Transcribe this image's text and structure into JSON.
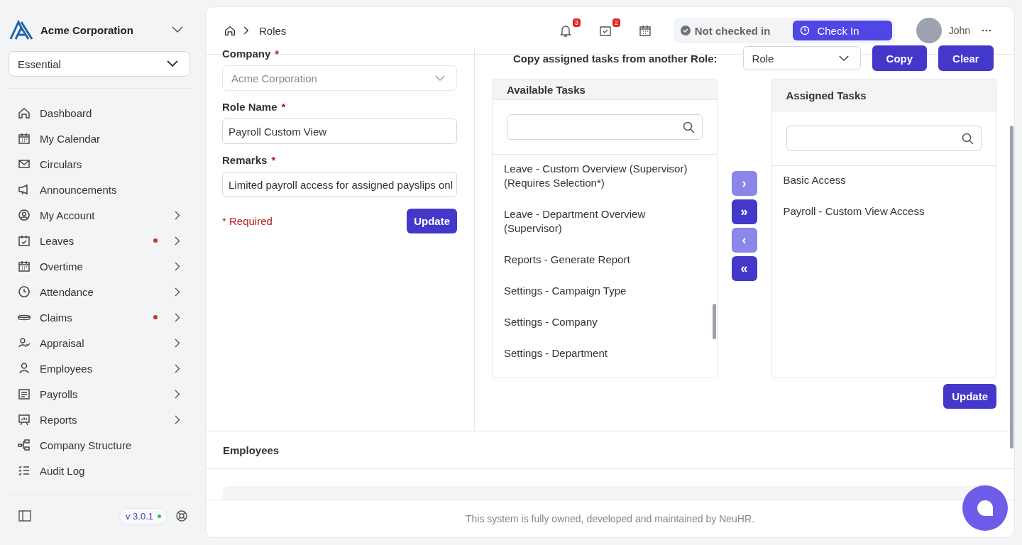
{
  "sidebar": {
    "company": "Acme Corporation",
    "plan": "Essential",
    "items": [
      {
        "label": "Dashboard",
        "expandable": false,
        "dot": false
      },
      {
        "label": "My Calendar",
        "expandable": false,
        "dot": false
      },
      {
        "label": "Circulars",
        "expandable": false,
        "dot": false
      },
      {
        "label": "Announcements",
        "expandable": false,
        "dot": false
      },
      {
        "label": "My Account",
        "expandable": true,
        "dot": false
      },
      {
        "label": "Leaves",
        "expandable": true,
        "dot": true
      },
      {
        "label": "Overtime",
        "expandable": true,
        "dot": false
      },
      {
        "label": "Attendance",
        "expandable": true,
        "dot": false
      },
      {
        "label": "Claims",
        "expandable": true,
        "dot": true
      },
      {
        "label": "Appraisal",
        "expandable": true,
        "dot": false
      },
      {
        "label": "Employees",
        "expandable": true,
        "dot": false
      },
      {
        "label": "Payrolls",
        "expandable": true,
        "dot": false
      },
      {
        "label": "Reports",
        "expandable": true,
        "dot": false
      },
      {
        "label": "Company Structure",
        "expandable": false,
        "dot": false
      },
      {
        "label": "Audit Log",
        "expandable": false,
        "dot": false
      }
    ],
    "version": "v 3.0.1"
  },
  "header": {
    "breadcrumb": "Roles",
    "notifications": "3",
    "tasks": "2",
    "status": "Not checked in",
    "check_in": "Check In",
    "user": "John"
  },
  "form": {
    "fields": [
      {
        "label": "Company",
        "required_mark": "*",
        "value": "Acme Corporation",
        "disabled": true,
        "kind": "select"
      },
      {
        "label": "Role Name",
        "required_mark": "*",
        "value": "Payroll Custom View",
        "disabled": false,
        "kind": "input"
      },
      {
        "label": "Remarks",
        "required_mark": "*",
        "value": "Limited payroll access for assigned payslips onl",
        "disabled": false,
        "kind": "input"
      }
    ],
    "required_note": "* Required",
    "update": "Update"
  },
  "copy": {
    "label": "Copy assigned tasks from another Role:",
    "select": "Role",
    "copy": "Copy",
    "clear": "Clear"
  },
  "available": {
    "title": "Available Tasks",
    "items": [
      "Leave - Custom Overview (Supervisor) (Requires Selection*)",
      "Leave - Department Overview (Supervisor)",
      "Reports - Generate Report",
      "Settings - Campaign Type",
      "Settings - Company",
      "Settings - Department"
    ]
  },
  "transfer": [
    {
      "symbol": "›",
      "disabled": true
    },
    {
      "symbol": "»",
      "disabled": false
    },
    {
      "symbol": "‹",
      "disabled": true
    },
    {
      "symbol": "«",
      "disabled": false
    }
  ],
  "assigned": {
    "title": "Assigned Tasks",
    "items": [
      "Basic Access",
      "Payroll - Custom View Access"
    ]
  },
  "update": "Update",
  "employees": {
    "title": "Employees"
  },
  "footer": "This system is fully owned, developed and maintained by NeuHR."
}
